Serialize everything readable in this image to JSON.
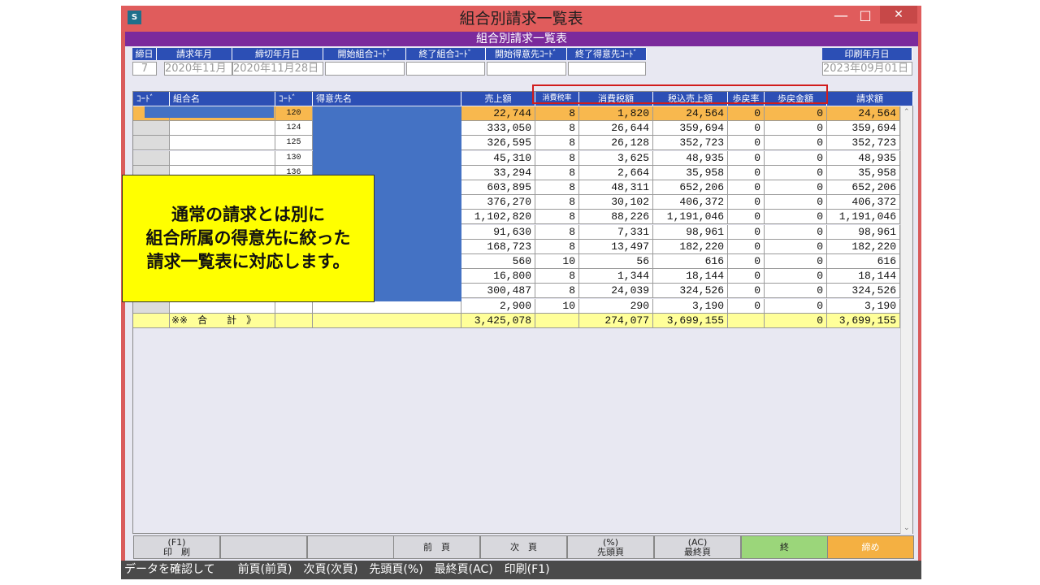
{
  "window": {
    "title": "組合別請求一覧表",
    "subtitle": "組合別請求一覧表",
    "app_icon": "S"
  },
  "header": {
    "labels": {
      "shime": "締日",
      "seikyu": "請求年月",
      "shimekiri": "締切年月日",
      "start_kumiai": "開始組合ｺｰﾄﾞ",
      "end_kumiai": "終了組合ｺｰﾄﾞ",
      "start_tokui": "開始得意先ｺｰﾄﾞ",
      "end_tokui": "終了得意先ｺｰﾄﾞ",
      "print_date": "印刷年月日"
    },
    "values": {
      "shime": "7",
      "seikyu": "2020年11月",
      "shimekiri": "2020年11月28日",
      "print_date": "2023年09月01日"
    }
  },
  "columns": {
    "code": "ｺｰﾄﾞ",
    "kumiai": "組合名",
    "code2": "ｺｰﾄﾞ",
    "tokui": "得意先名",
    "sales": "売上額",
    "tax_rate": "消費税率",
    "tax": "消費税額",
    "incl": "税込売上額",
    "rebate_rate": "歩戻率",
    "rebate": "歩戻金額",
    "bill": "請求額"
  },
  "rows": [
    {
      "code": "120",
      "sales": "22,744",
      "rate": "8",
      "tax": "1,820",
      "incl": "24,564",
      "rrate": "0",
      "rebate": "0",
      "bill": "24,564"
    },
    {
      "code": "124",
      "sales": "333,050",
      "rate": "8",
      "tax": "26,644",
      "incl": "359,694",
      "rrate": "0",
      "rebate": "0",
      "bill": "359,694"
    },
    {
      "code": "125",
      "sales": "326,595",
      "rate": "8",
      "tax": "26,128",
      "incl": "352,723",
      "rrate": "0",
      "rebate": "0",
      "bill": "352,723"
    },
    {
      "code": "130",
      "sales": "45,310",
      "rate": "8",
      "tax": "3,625",
      "incl": "48,935",
      "rrate": "0",
      "rebate": "0",
      "bill": "48,935"
    },
    {
      "code": "136",
      "sales": "33,294",
      "rate": "8",
      "tax": "2,664",
      "incl": "35,958",
      "rrate": "0",
      "rebate": "0",
      "bill": "35,958"
    },
    {
      "code": "",
      "sales": "603,895",
      "rate": "8",
      "tax": "48,311",
      "incl": "652,206",
      "rrate": "0",
      "rebate": "0",
      "bill": "652,206"
    },
    {
      "code": "",
      "sales": "376,270",
      "rate": "8",
      "tax": "30,102",
      "incl": "406,372",
      "rrate": "0",
      "rebate": "0",
      "bill": "406,372"
    },
    {
      "code": "",
      "sales": "1,102,820",
      "rate": "8",
      "tax": "88,226",
      "incl": "1,191,046",
      "rrate": "0",
      "rebate": "0",
      "bill": "1,191,046"
    },
    {
      "code": "",
      "sales": "91,630",
      "rate": "8",
      "tax": "7,331",
      "incl": "98,961",
      "rrate": "0",
      "rebate": "0",
      "bill": "98,961"
    },
    {
      "code": "",
      "sales": "168,723",
      "rate": "8",
      "tax": "13,497",
      "incl": "182,220",
      "rrate": "0",
      "rebate": "0",
      "bill": "182,220"
    },
    {
      "code": "",
      "sales": "560",
      "rate": "10",
      "tax": "56",
      "incl": "616",
      "rrate": "0",
      "rebate": "0",
      "bill": "616"
    },
    {
      "code": "",
      "sales": "16,800",
      "rate": "8",
      "tax": "1,344",
      "incl": "18,144",
      "rrate": "0",
      "rebate": "0",
      "bill": "18,144"
    },
    {
      "code": "",
      "sales": "300,487",
      "rate": "8",
      "tax": "24,039",
      "incl": "324,526",
      "rrate": "0",
      "rebate": "0",
      "bill": "324,526"
    },
    {
      "code": "",
      "sales": "2,900",
      "rate": "10",
      "tax": "290",
      "incl": "3,190",
      "rrate": "0",
      "rebate": "0",
      "bill": "3,190"
    }
  ],
  "total": {
    "label": "※※　合　　計　》",
    "sales": "3,425,078",
    "tax": "274,077",
    "incl": "3,699,155",
    "rebate": "0",
    "bill": "3,699,155"
  },
  "fkeys": [
    {
      "top": "(F1)",
      "label": "印　刷"
    },
    {
      "top": "",
      "label": ""
    },
    {
      "top": "",
      "label": ""
    },
    {
      "top": "",
      "label": "前　頁"
    },
    {
      "top": "",
      "label": "次　頁"
    },
    {
      "top": "(%)",
      "label": "先頭頁"
    },
    {
      "top": "(AC)",
      "label": "最終頁"
    },
    {
      "top": "",
      "label": "終"
    },
    {
      "top": "",
      "label": "締め"
    }
  ],
  "status": "データを確認して　　前頁(前頁)　次頁(次頁)　先頭頁(%)　最終頁(AC)　印刷(F1)",
  "callout": {
    "line1": "通常の請求とは別に",
    "line2": "組合所属の得意先に絞った",
    "line3": "請求一覧表に対応します。"
  },
  "colors": {
    "title_bar": "#e05c5c",
    "subtitle_bar": "#7b2a9c",
    "header_blue": "#2c4fb5",
    "selected_row": "#f8b84e",
    "total_row": "#ffff99",
    "callout": "#ffff00",
    "highlight_box": "#d11c1c"
  }
}
